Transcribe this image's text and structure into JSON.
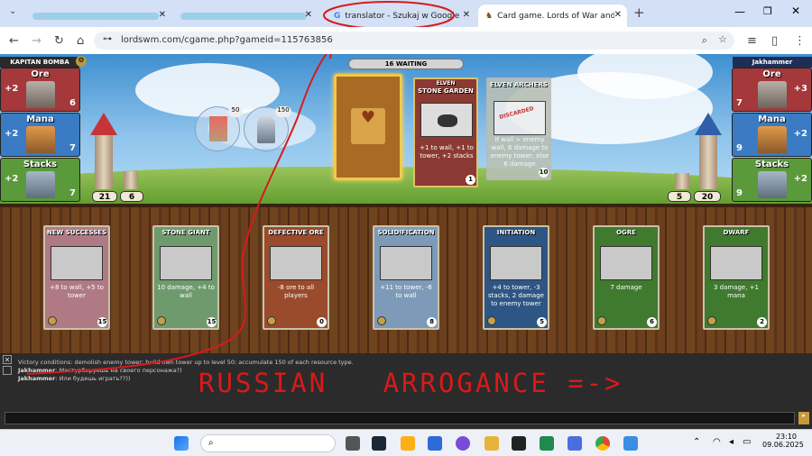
{
  "browser": {
    "tabs": [
      {
        "label": "",
        "active": false
      },
      {
        "label": "",
        "active": false
      },
      {
        "label": "translator - Szukaj w Google",
        "active": false
      },
      {
        "label": "Card game. Lords of War and M",
        "active": true
      }
    ],
    "new_tab": "+",
    "url": "lordswm.com/cgame.php?gameid=115763856"
  },
  "game": {
    "left_player": {
      "name": "KAPITAN BOMBA",
      "tower": "21",
      "wall": "6",
      "resources": [
        {
          "label": "Ore",
          "income": "+2",
          "count": "6"
        },
        {
          "label": "Mana",
          "income": "+2",
          "count": "7"
        },
        {
          "label": "Stacks",
          "income": "+2",
          "count": "7"
        }
      ]
    },
    "right_player": {
      "name": "Jakhammer",
      "tower": "20",
      "wall": "5",
      "resources": [
        {
          "label": "Ore",
          "income": "+3",
          "count": "7"
        },
        {
          "label": "Mana",
          "income": "+2",
          "count": "9"
        },
        {
          "label": "Stacks",
          "income": "+2",
          "count": "9"
        }
      ]
    },
    "goal_tower": "50",
    "goal_resource": "150",
    "waiting": {
      "count": "16",
      "label": "WAITING"
    },
    "played": [
      {
        "title": "STONE GARDEN",
        "subtitle": "ELVEN",
        "desc": "+1 to wall, +1 to tower, +2 stacks",
        "cost": "1"
      },
      {
        "title": "ELVEN ARCHERS",
        "desc": "If wall > enemy wall, 6 damage to enemy tower; else 6 damage",
        "cost": "10",
        "badge": "DISCARDED"
      }
    ],
    "hand": [
      {
        "title": "NEW SUCCESSES",
        "desc": "+8 to wall, +5 to tower",
        "cost": "15",
        "color": "#b07a85"
      },
      {
        "title": "STONE GIANT",
        "desc": "10 damage, +4 to wall",
        "cost": "15",
        "color": "#6f9a6e"
      },
      {
        "title": "DEFECTIVE ORE",
        "desc": "-8 ore to all players",
        "cost": "0",
        "color": "#9a4b2c"
      },
      {
        "title": "SOLIDIFICATION",
        "desc": "+11 to tower, -6 to wall",
        "cost": "8",
        "color": "#7d9bb9"
      },
      {
        "title": "INITIATION",
        "desc": "+4 to tower, -3 stacks, 2 damage to enemy tower",
        "cost": "5",
        "color": "#2d5684"
      },
      {
        "title": "OGRE",
        "desc": "7 damage",
        "cost": "6",
        "color": "#3f7a2f"
      },
      {
        "title": "DWARF",
        "desc": "3 damage, +1 mana",
        "cost": "2",
        "color": "#3f7a2f"
      }
    ],
    "log": [
      {
        "text": "Victory conditions: demolish enemy tower; build own tower up to level 50; accumulate 150 of each resource type."
      },
      {
        "who": "Jakhammer",
        "text": ": Мастурбируешь на своего персонажа?)"
      },
      {
        "who": "Jakhammer",
        "text": ": Или будешь играть??))"
      }
    ],
    "annotation": "RUSSIAN   ARROGANCE =->"
  },
  "taskbar": {
    "time": "23:10",
    "date": "09.06.2025"
  },
  "colors": {
    "ore": "#a4383a",
    "mana": "#3a7bc4",
    "stacks": "#5a9a3a",
    "annotation": "#d81a1a"
  }
}
